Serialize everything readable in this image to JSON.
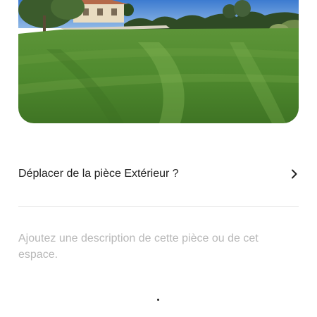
{
  "photo": {
    "alt_name": "lawn-photo",
    "colors": {
      "sky": "#4a86d4",
      "grass": "#4f8a2e",
      "grass_light": "#7fae4f",
      "house": "#e9dcc1",
      "trees": "#2f4a25"
    }
  },
  "move_room": {
    "prefix": "Déplacer de la pièce ",
    "room_name": "Extérieur",
    "suffix": " ?",
    "chevron_icon": "chevron-right-icon"
  },
  "description": {
    "value": "",
    "placeholder": "Ajoutez une description de cette pièce ou de cet espace."
  },
  "colors": {
    "text_primary": "#222222",
    "placeholder": "#b8b8b8",
    "divider": "#e6e6e6"
  }
}
